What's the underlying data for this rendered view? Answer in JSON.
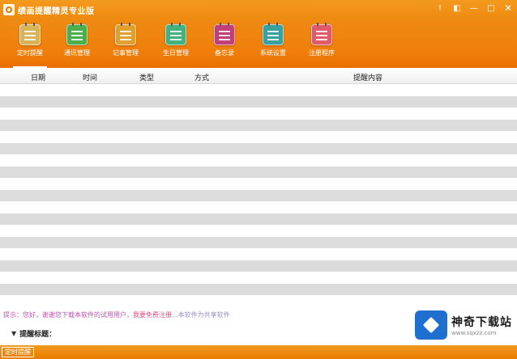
{
  "window": {
    "title": "绩画提醒精灵专业版",
    "controls": [
      "help-icon",
      "skin-icon",
      "minimize-icon",
      "maximize-icon",
      "close-icon"
    ],
    "control_glyphs": [
      "!",
      "◧",
      "—",
      "□",
      "✕"
    ]
  },
  "toolbar": {
    "items": [
      {
        "label": "定时提醒",
        "icon": "alarm-icon",
        "color": "#d9b35a"
      },
      {
        "label": "通讯管理",
        "icon": "contacts-icon",
        "color": "#4cae4c"
      },
      {
        "label": "记事管理",
        "icon": "notes-icon",
        "color": "#e0a030"
      },
      {
        "label": "生日管理",
        "icon": "birthday-icon",
        "color": "#45b080"
      },
      {
        "label": "备忘录",
        "icon": "memo-icon",
        "color": "#c0407a"
      },
      {
        "label": "系统设置",
        "icon": "settings-icon",
        "color": "#3aa0a0"
      },
      {
        "label": "注册程序",
        "icon": "register-icon",
        "color": "#e05a6a"
      }
    ]
  },
  "grid": {
    "columns": [
      "日期",
      "时间",
      "类型",
      "方式",
      "提醒内容"
    ],
    "row_count": 18
  },
  "hint": {
    "prefix": "提示：",
    "main": "您好，谢谢您下载本软件的试用用户，",
    "highlight": "我要免费注册",
    "tail": "...本软件为共享软件"
  },
  "remind": {
    "label": "提醒标题："
  },
  "status": {
    "badge": "定时提醒"
  },
  "watermark": {
    "name": "神奇下载站",
    "url": "www.sqxzz.com"
  }
}
